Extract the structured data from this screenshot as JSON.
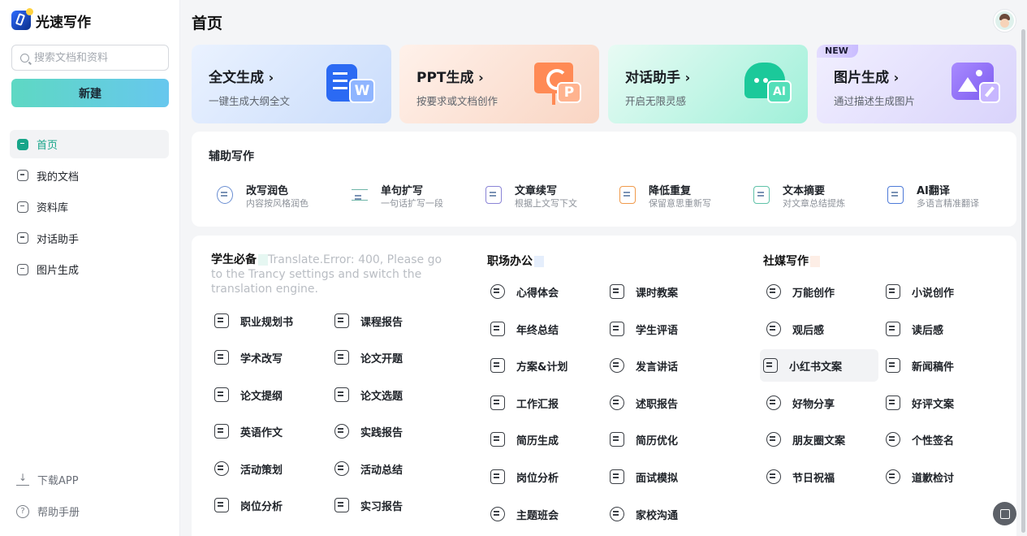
{
  "app": {
    "name": "光速写作"
  },
  "search": {
    "placeholder": "搜索文档和资料"
  },
  "new_button": "新建",
  "nav": [
    {
      "label": "首页",
      "icon": "home-icon",
      "active": true
    },
    {
      "label": "我的文档",
      "icon": "document-icon"
    },
    {
      "label": "资料库",
      "icon": "library-icon"
    },
    {
      "label": "对话助手",
      "icon": "chat-icon"
    },
    {
      "label": "图片生成",
      "icon": "image-icon"
    }
  ],
  "bottom": {
    "download": "下载APP",
    "help": "帮助手册"
  },
  "page_title": "首页",
  "cards": [
    {
      "title": "全文生成",
      "subtitle": "一键生成大纲全文",
      "art_text": "W"
    },
    {
      "title": "PPT生成",
      "subtitle": "按要求或文档创作",
      "art_text": "P"
    },
    {
      "title": "对话助手",
      "subtitle": "开启无限灵感",
      "art_text": "AI"
    },
    {
      "title": "图片生成",
      "subtitle": "通过描述生成图片",
      "badge": "NEW"
    }
  ],
  "assist": {
    "title": "辅助写作",
    "tools": [
      {
        "name": "改写润色",
        "desc": "内容按风格润色"
      },
      {
        "name": "单句扩写",
        "desc": "一句话扩写一段"
      },
      {
        "name": "文章续写",
        "desc": "根据上文写下文"
      },
      {
        "name": "降低重复",
        "desc": "保留意思重新写"
      },
      {
        "name": "文本摘要",
        "desc": "对文章总结提炼"
      },
      {
        "name": "AI翻译",
        "desc": "多语言精准翻译"
      }
    ]
  },
  "templates": {
    "student": {
      "title": "学生必备",
      "error": "Translate.Error: 400, Please go to the Trancy settings and switch the translation engine.",
      "items": [
        "职业规划书",
        "课程报告",
        "学术改写",
        "论文开题",
        "论文提纲",
        "论文选题",
        "英语作文",
        "实践报告",
        "活动策划",
        "活动总结",
        "岗位分析",
        "实习报告"
      ]
    },
    "office": {
      "title": "职场办公",
      "items": [
        "心得体会",
        "课时教案",
        "年终总结",
        "学生评语",
        "方案&计划",
        "发言讲话",
        "工作汇报",
        "述职报告",
        "简历生成",
        "简历优化",
        "岗位分析",
        "面试模拟",
        "主题班会",
        "家校沟通"
      ]
    },
    "social": {
      "title": "社媒写作",
      "items": [
        "万能创作",
        "小说创作",
        "观后感",
        "读后感",
        "小红书文案",
        "新闻稿件",
        "好物分享",
        "好评文案",
        "朋友圈文案",
        "个性签名",
        "节日祝福",
        "道歉检讨"
      ]
    }
  }
}
